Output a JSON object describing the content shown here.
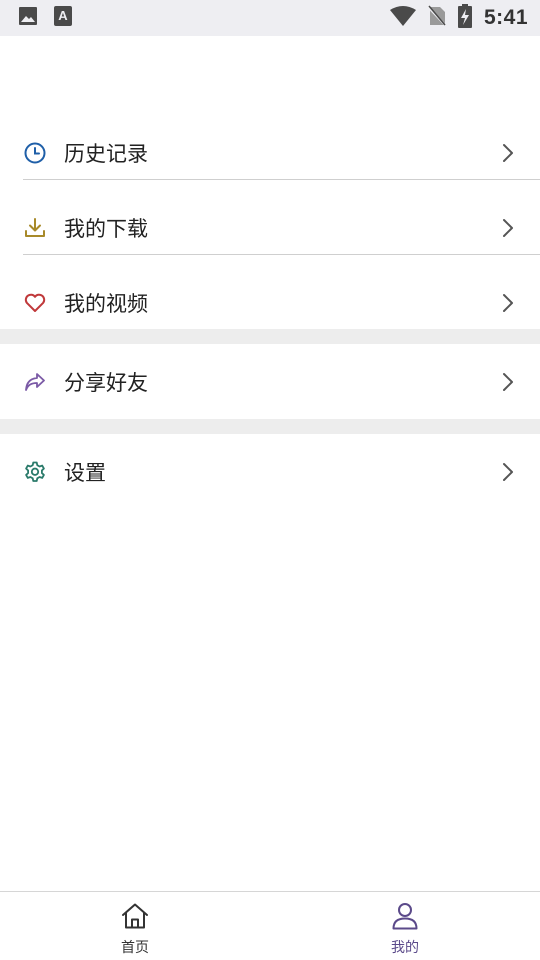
{
  "status_bar": {
    "time": "5:41",
    "icons": [
      "image-icon",
      "text-a-icon",
      "wifi-icon",
      "no-sim-icon",
      "battery-charging-icon"
    ]
  },
  "menu": {
    "group1": [
      {
        "label": "历史记录",
        "icon": "clock-icon",
        "icon_color": "#1f5fa8"
      },
      {
        "label": "我的下载",
        "icon": "download-icon",
        "icon_color": "#a88a2a"
      },
      {
        "label": "我的视频",
        "icon": "heart-icon",
        "icon_color": "#c0393b"
      }
    ],
    "group2": [
      {
        "label": "分享好友",
        "icon": "share-icon",
        "icon_color": "#7b5aa6"
      }
    ],
    "group3": [
      {
        "label": "设置",
        "icon": "gear-icon",
        "icon_color": "#2a7a6a"
      }
    ]
  },
  "bottom_nav": {
    "tabs": [
      {
        "label": "首页",
        "icon": "home-icon",
        "active": false
      },
      {
        "label": "我的",
        "icon": "user-icon",
        "active": true
      }
    ],
    "active_color": "#5b4a8a"
  }
}
